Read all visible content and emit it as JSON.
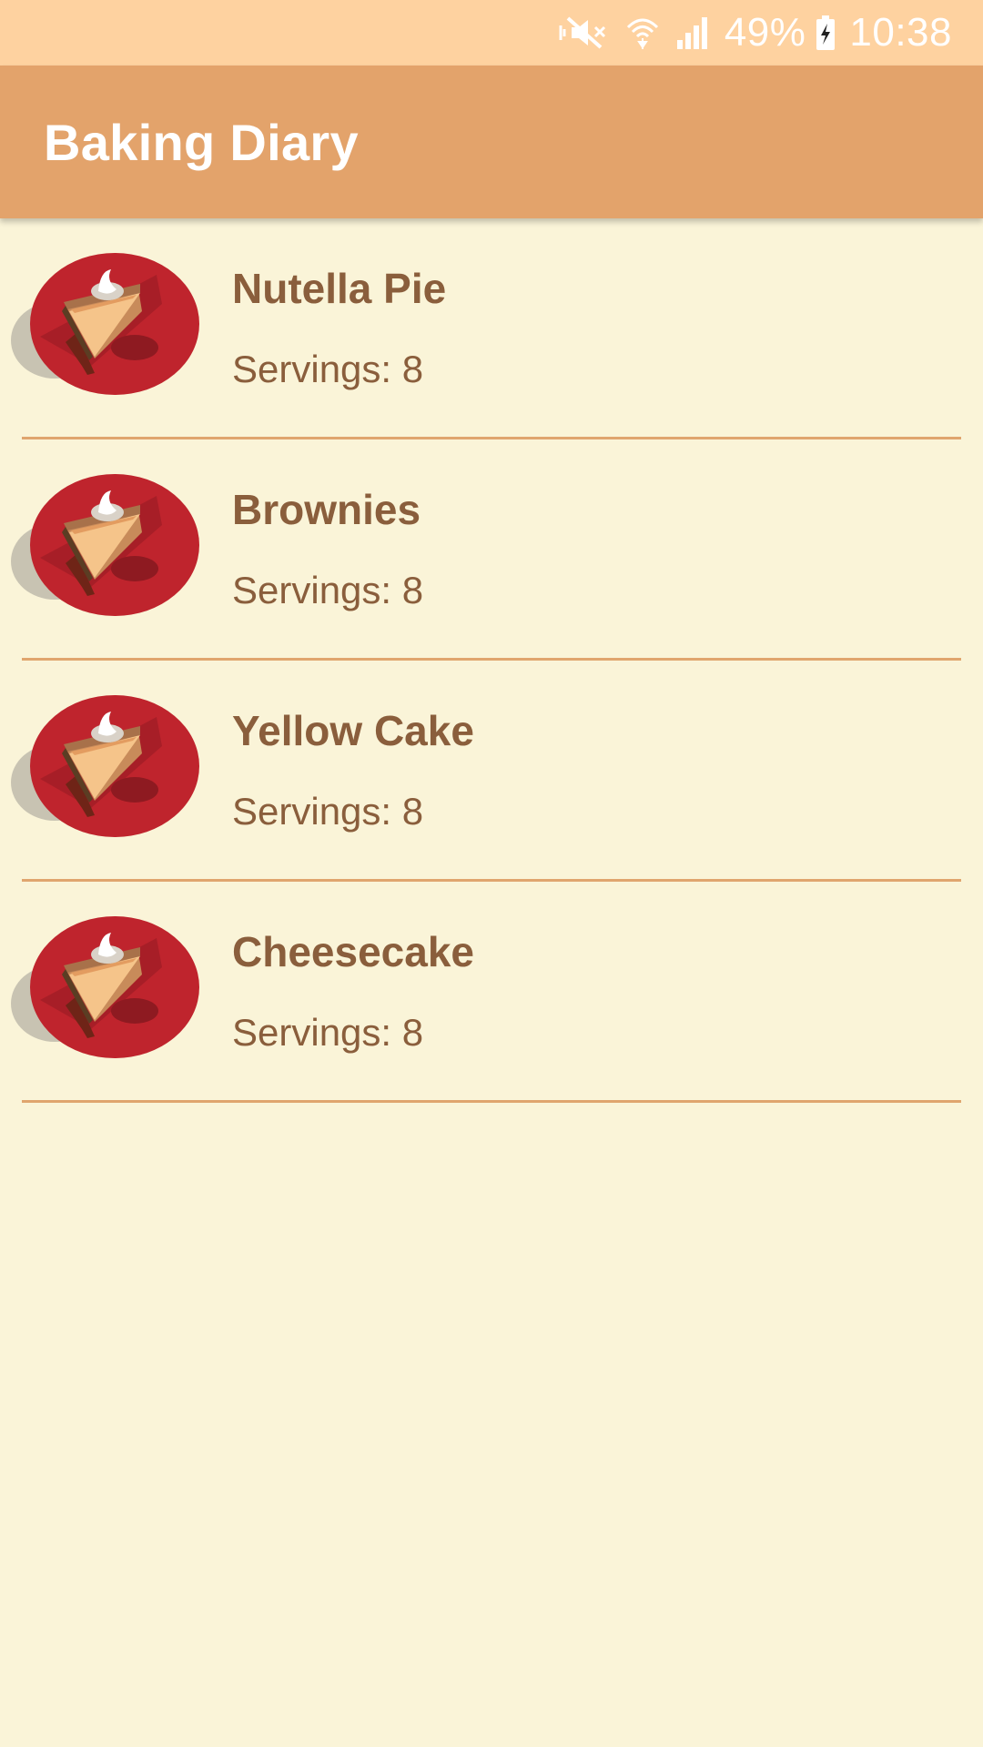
{
  "status_bar": {
    "battery_percent": "49%",
    "time": "10:38",
    "icons": [
      "mute-icon",
      "wifi-icon",
      "signal-icon",
      "battery-charging-icon"
    ]
  },
  "app_bar": {
    "title": "Baking Diary"
  },
  "colors": {
    "status_bar": "#FED2A0",
    "app_bar": "#E3A36B",
    "background": "#FAF4D8",
    "text": "#8A5E3C",
    "divider": "#E0A56E",
    "plate": "#BF242D"
  },
  "recipes": [
    {
      "name": "Nutella Pie",
      "servings": "Servings: 8",
      "icon": "pie-slice-icon"
    },
    {
      "name": "Brownies",
      "servings": "Servings: 8",
      "icon": "pie-slice-icon"
    },
    {
      "name": "Yellow Cake",
      "servings": "Servings: 8",
      "icon": "pie-slice-icon"
    },
    {
      "name": "Cheesecake",
      "servings": "Servings: 8",
      "icon": "pie-slice-icon"
    }
  ]
}
